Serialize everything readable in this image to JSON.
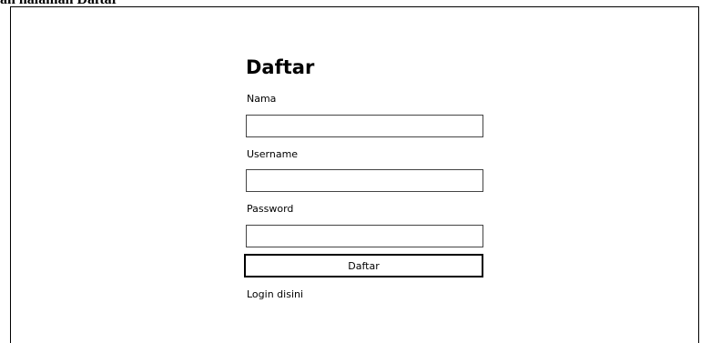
{
  "caption": "gan halaman Daftar",
  "form": {
    "title": "Daftar",
    "fields": [
      {
        "label": "Nama",
        "value": "",
        "placeholder": ""
      },
      {
        "label": "Username",
        "value": "",
        "placeholder": ""
      },
      {
        "label": "Password",
        "value": "",
        "placeholder": ""
      }
    ],
    "submit_label": "Daftar",
    "login_link_label": "Login disini"
  }
}
